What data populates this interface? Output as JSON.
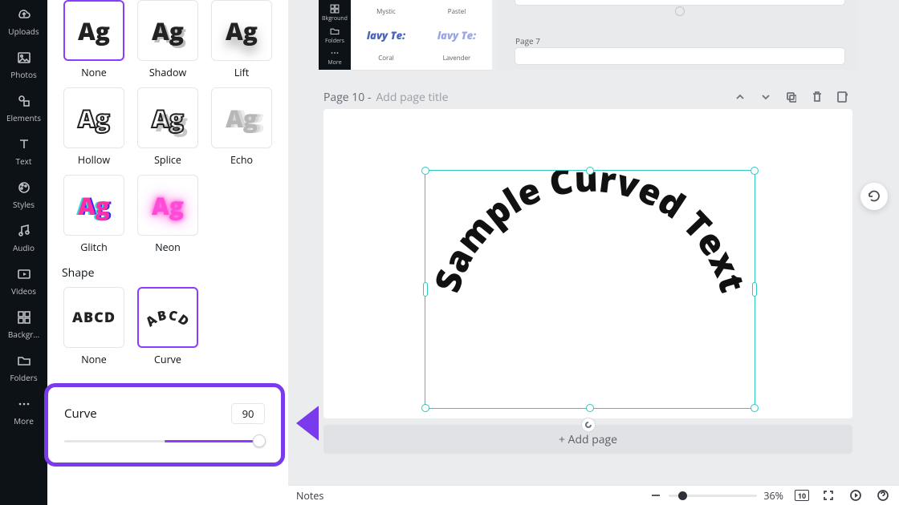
{
  "rail": [
    {
      "label": "Uploads",
      "icon": "cloud"
    },
    {
      "label": "Photos",
      "icon": "image"
    },
    {
      "label": "Elements",
      "icon": "shapes"
    },
    {
      "label": "Text",
      "icon": "text"
    },
    {
      "label": "Styles",
      "icon": "palette"
    },
    {
      "label": "Audio",
      "icon": "music"
    },
    {
      "label": "Videos",
      "icon": "video"
    },
    {
      "label": "Backgr…",
      "icon": "grid"
    },
    {
      "label": "Folders",
      "icon": "folder"
    },
    {
      "label": "More",
      "icon": "more"
    }
  ],
  "effects": {
    "items": [
      {
        "label": "None",
        "style": "none",
        "selected": true
      },
      {
        "label": "Shadow",
        "style": "sha"
      },
      {
        "label": "Lift",
        "style": "lift"
      },
      {
        "label": "Hollow",
        "style": "hol"
      },
      {
        "label": "Splice",
        "style": "spl"
      },
      {
        "label": "Echo",
        "style": "echo"
      },
      {
        "label": "Glitch",
        "style": "gli"
      },
      {
        "label": "Neon",
        "style": "neon"
      }
    ],
    "sample": "Ag"
  },
  "shape": {
    "title": "Shape",
    "items": [
      {
        "label": "None",
        "selected": false
      },
      {
        "label": "Curve",
        "selected": true
      }
    ],
    "sample": "ABCD"
  },
  "curve": {
    "label": "Curve",
    "value": "90"
  },
  "strip": [
    {
      "label": "Bkground",
      "icon": "grid"
    },
    {
      "label": "Folders",
      "icon": "folder"
    },
    {
      "label": "More",
      "icon": "more"
    }
  ],
  "mini": {
    "row1": [
      "Mystic",
      "Pastel"
    ],
    "row2": [
      {
        "text": "lavy Te:"
      },
      {
        "text": "lavy Te:"
      }
    ],
    "row3": [
      "Coral",
      "Lavender"
    ],
    "page7": "Page 7"
  },
  "page": {
    "label": "Page 10 -",
    "prompt": "Add page title",
    "add": "+ Add page",
    "text": "Sample Curved Text"
  },
  "bottom": {
    "notes": "Notes",
    "zoom": "36%"
  }
}
